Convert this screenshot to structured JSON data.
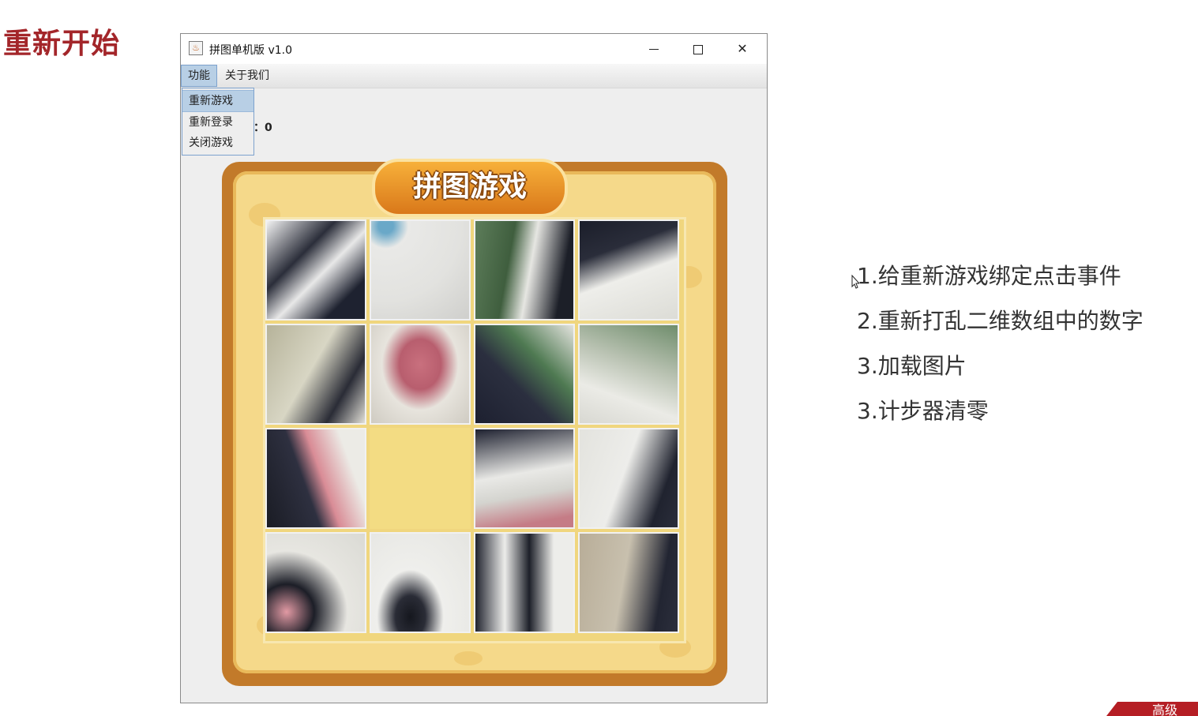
{
  "slide": {
    "title": "重新开始"
  },
  "window": {
    "title": "拼图单机版 v1.0",
    "menu": {
      "func": "功能",
      "about": "关于我们"
    },
    "dropdown": [
      "重新游戏",
      "重新登录",
      "关闭游戏"
    ],
    "step_label": "：0",
    "logo_text": "拼图游戏"
  },
  "notes": [
    "1.给重新游戏绑定点击事件",
    "2.重新打乱二维数组中的数字",
    "3.加载图片",
    "3.计步器清零"
  ],
  "corner_text": "高级",
  "colors": {
    "title_red": "#a3262a",
    "menu_highlight": "#b8cfe5",
    "board_yellow": "#f5d98a"
  }
}
